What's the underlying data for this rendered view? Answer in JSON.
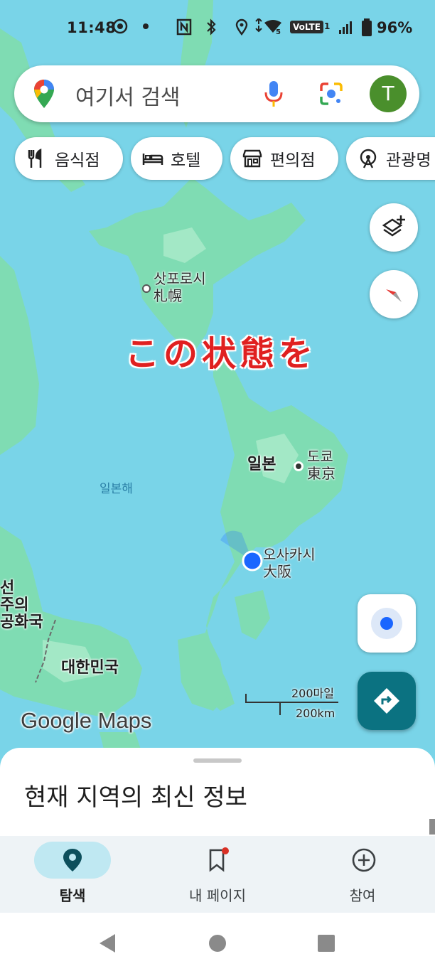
{
  "status_bar": {
    "time": "11:48",
    "network_badge": "VoLTE",
    "sim_slot": "1",
    "wifi_badge": "5",
    "battery": "96%"
  },
  "search": {
    "placeholder": "여기서 검색",
    "avatar_initial": "T"
  },
  "chips": [
    {
      "label": "음식점",
      "icon": "restaurant-icon"
    },
    {
      "label": "호텔",
      "icon": "hotel-icon"
    },
    {
      "label": "편의점",
      "icon": "store-icon"
    },
    {
      "label": "관광명",
      "icon": "attraction-icon"
    }
  ],
  "map": {
    "annotation": "この状態を",
    "labels": {
      "sapporo_ko": "삿포로시",
      "sapporo_ja": "札幌",
      "japan": "일본",
      "tokyo_ko": "도쿄",
      "tokyo_ja": "東京",
      "sea_of_japan": "일본해",
      "osaka_ko": "오사카시",
      "osaka_ja": "大阪",
      "nk_1": "선",
      "nk_2": "주의",
      "nk_3": "공화국",
      "korea": "대한민국"
    },
    "brand": "Google Maps",
    "scale_miles": "200마일",
    "scale_km": "200km",
    "colors": {
      "water": "#79d4e8",
      "land": "#7fdcb3",
      "location": "#1a66ff",
      "annotation": "#e02020"
    }
  },
  "sheet": {
    "title": "현재 지역의 최신 정보"
  },
  "nav": [
    {
      "label": "탐색",
      "icon": "explore-pin-icon",
      "active": true
    },
    {
      "label": "내 페이지",
      "icon": "bookmark-icon",
      "active": false
    },
    {
      "label": "참여",
      "icon": "add-circle-icon",
      "active": false
    }
  ]
}
